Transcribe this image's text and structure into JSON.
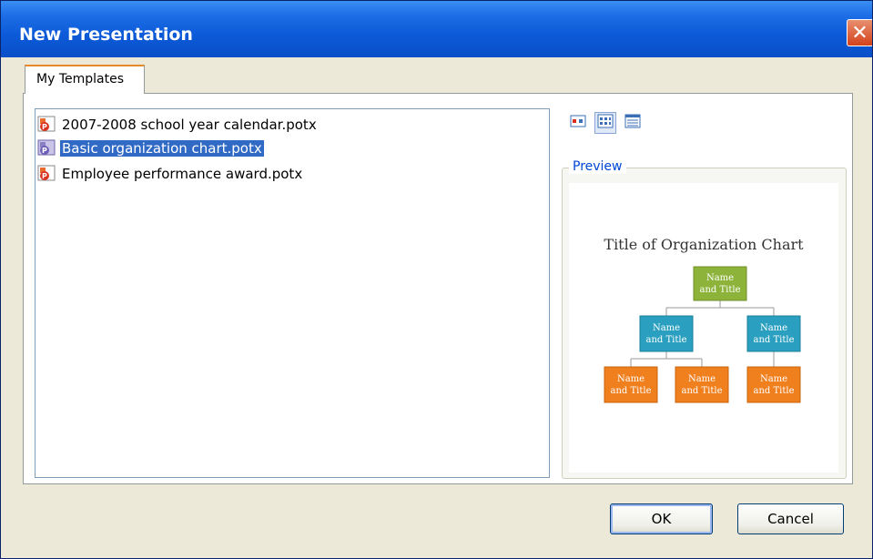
{
  "window": {
    "title": "New Presentation"
  },
  "tabs": [
    {
      "label": "My Templates"
    }
  ],
  "files": [
    {
      "label": "2007-2008 school year calendar.potx",
      "selected": false
    },
    {
      "label": "Basic organization chart.potx",
      "selected": true
    },
    {
      "label": "Employee performance award.potx",
      "selected": false
    }
  ],
  "view_buttons": [
    "large-icons-view-icon",
    "list-view-icon",
    "details-view-icon"
  ],
  "preview": {
    "label": "Preview",
    "slide_title": "Title of Organization Chart",
    "nodes": [
      {
        "line1": "Name",
        "line2": "and Title"
      },
      {
        "line1": "Name",
        "line2": "and Title"
      },
      {
        "line1": "Name",
        "line2": "and Title"
      },
      {
        "line1": "Name",
        "line2": "and Title"
      },
      {
        "line1": "Name",
        "line2": "and Title"
      },
      {
        "line1": "Name",
        "line2": "and Title"
      }
    ]
  },
  "buttons": {
    "ok": "OK",
    "cancel": "Cancel"
  },
  "colors": {
    "titlebar": "#0A50C8",
    "selection": "#316AC5",
    "node_green": "#8DB33A",
    "node_blue": "#2A9FBF",
    "node_orange": "#F07F1E"
  }
}
